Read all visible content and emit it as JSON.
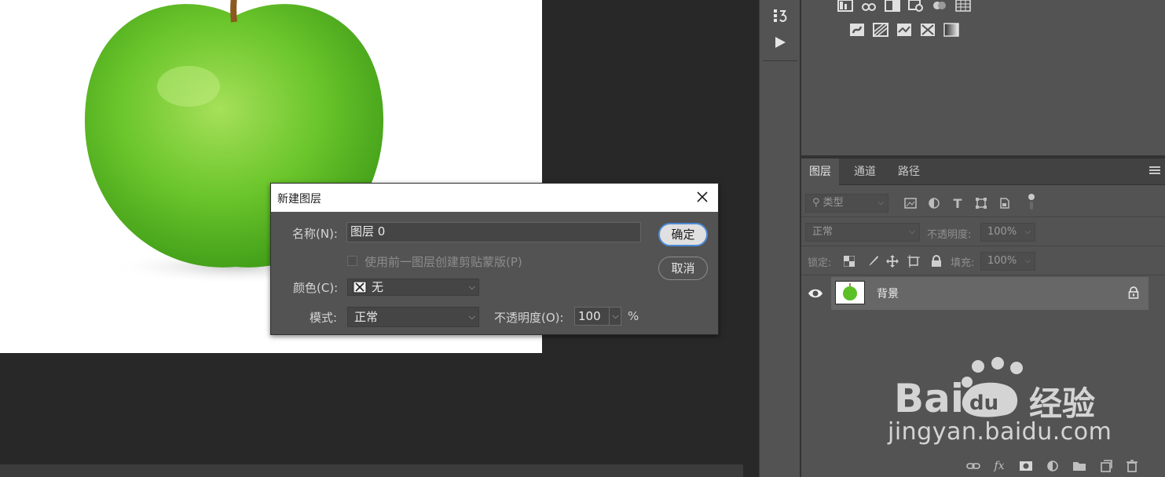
{
  "dialog": {
    "title": "新建图层",
    "name_label": "名称(N):",
    "name_value": "图层 0",
    "clip_label": "使用前一图层创建剪贴蒙版(P)",
    "color_label": "颜色(C):",
    "color_value": "无",
    "mode_label": "模式:",
    "mode_value": "正常",
    "opacity_label": "不透明度(O):",
    "opacity_value": "100",
    "opacity_unit": "%",
    "ok_label": "确定",
    "cancel_label": "取消"
  },
  "layers_panel": {
    "tabs": [
      "图层",
      "通道",
      "路径"
    ],
    "filter_placeholder": "类型",
    "blend_mode": "正常",
    "opacity_label": "不透明度:",
    "opacity_value": "100%",
    "lock_label": "锁定:",
    "fill_label": "填充:",
    "fill_value": "100%",
    "layers": [
      {
        "name": "背景",
        "visible": true,
        "locked": true
      }
    ]
  },
  "watermark": {
    "brand": "Bai",
    "brand_du": "du",
    "brand_cn": "经验",
    "url": "jingyan.baidu.com"
  },
  "colors": {
    "panel_bg": "#535353",
    "canvas_bg": "#282828",
    "accent": "#4d8ad6"
  }
}
